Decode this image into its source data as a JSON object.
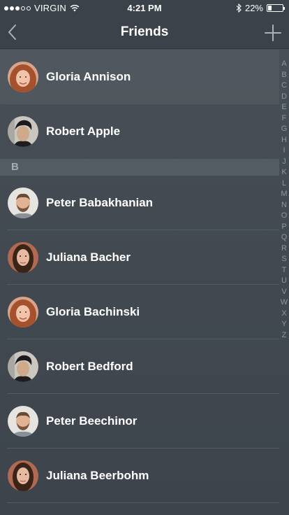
{
  "status_bar": {
    "carrier": "VIRGIN",
    "time": "4:21 PM",
    "battery": "22%",
    "battery_level": 0.22,
    "signal_bars": 3,
    "signal_total": 5
  },
  "nav": {
    "title": "Friends",
    "back_icon": "chevron-left-icon",
    "add_icon": "plus-icon"
  },
  "sections": [
    {
      "header": "",
      "items": [
        {
          "name": "Gloria Annison",
          "avatar": "woman-redhead"
        },
        {
          "name": "Robert Apple",
          "avatar": "man-dark"
        }
      ]
    },
    {
      "header": "B",
      "items": [
        {
          "name": "Peter Babakhanian",
          "avatar": "man-beard"
        },
        {
          "name": "Juliana Bacher",
          "avatar": "woman-brunette"
        },
        {
          "name": "Gloria Bachinski",
          "avatar": "woman-redhead"
        },
        {
          "name": "Robert Bedford",
          "avatar": "man-dark"
        },
        {
          "name": "Peter Beechinor",
          "avatar": "man-beard"
        },
        {
          "name": "Juliana Beerbohm",
          "avatar": "woman-brunette"
        }
      ]
    }
  ],
  "index_letters": [
    "A",
    "B",
    "C",
    "D",
    "E",
    "F",
    "G",
    "H",
    "I",
    "J",
    "K",
    "L",
    "M",
    "N",
    "O",
    "P",
    "Q",
    "R",
    "S",
    "T",
    "U",
    "V",
    "W",
    "X",
    "Y",
    "Z"
  ],
  "colors": {
    "background": "#434a52",
    "bar": "#3b4249",
    "section_header": "#535b63",
    "index_text": "#8e969e"
  }
}
